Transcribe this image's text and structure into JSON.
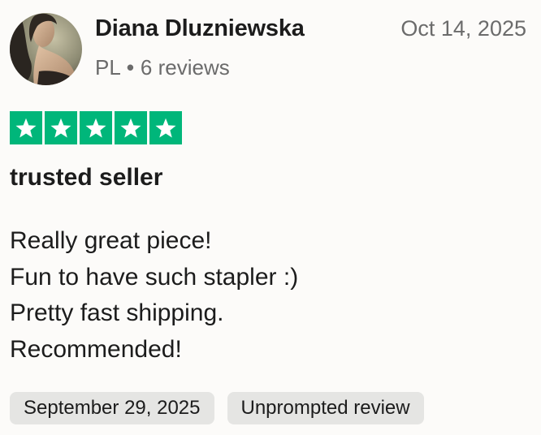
{
  "reviewer": {
    "name": "Diana Dluzniewska",
    "country": "PL",
    "separator": "•",
    "reviews_count": "6 reviews"
  },
  "review": {
    "date": "Oct 14, 2025",
    "rating": 5,
    "rating_max": 5,
    "title": "trusted seller",
    "body_lines": [
      "Really great piece!",
      "Fun to have such stapler :)",
      "Pretty fast shipping.",
      "Recommended!"
    ],
    "experience_date": "September 29, 2025",
    "review_type": "Unprompted review"
  },
  "colors": {
    "star_fill": "#00b67a",
    "star_glyph": "#ffffff",
    "chip_background": "#e5e5e3",
    "muted_text": "#6b6b6b"
  },
  "icons": {
    "avatar": "user-avatar-photo",
    "star": "star-icon"
  }
}
